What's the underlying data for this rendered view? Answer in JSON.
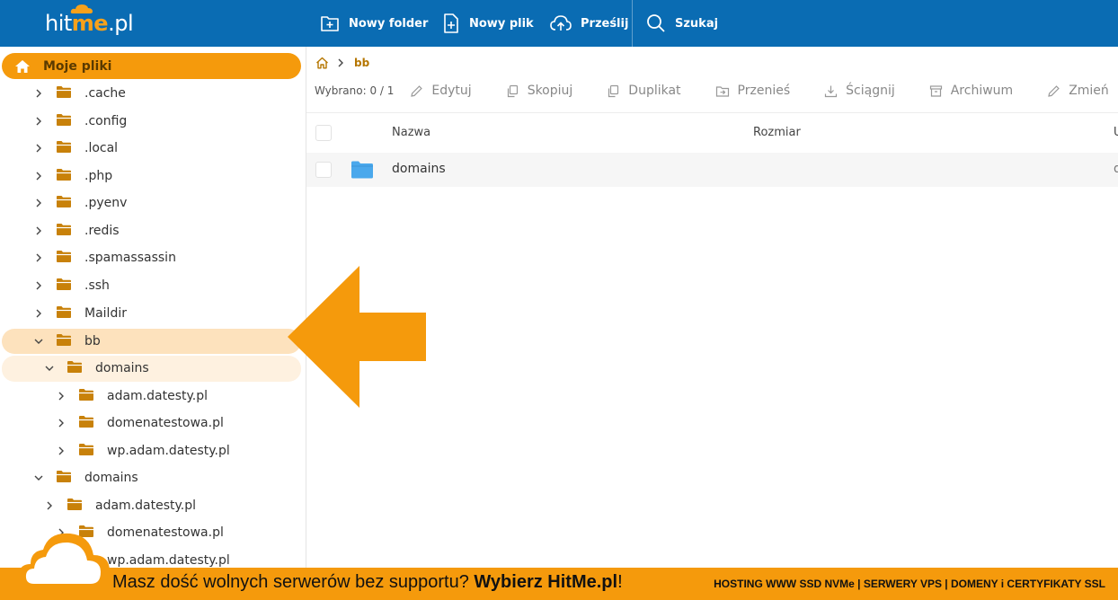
{
  "app": {
    "logo_text_hit": "hit",
    "logo_text_me": "me",
    "logo_text_tld": ".pl"
  },
  "toolbar": {
    "new_folder": "Nowy folder",
    "new_file": "Nowy plik",
    "upload": "Prześlij",
    "search": "Szukaj"
  },
  "sidebar": {
    "home_label": "Moje pliki",
    "items": [
      {
        "label": ".cache"
      },
      {
        "label": ".config"
      },
      {
        "label": ".local"
      },
      {
        "label": ".php"
      },
      {
        "label": ".pyenv"
      },
      {
        "label": ".redis"
      },
      {
        "label": ".spamassassin"
      },
      {
        "label": ".ssh"
      },
      {
        "label": "Maildir"
      },
      {
        "label": "bb"
      },
      {
        "label": "domains"
      },
      {
        "label": "adam.datesty.pl"
      },
      {
        "label": "domenatestowa.pl"
      },
      {
        "label": "wp.adam.datesty.pl"
      },
      {
        "label": "domains"
      },
      {
        "label": "adam.datesty.pl"
      },
      {
        "label": "domenatestowa.pl"
      },
      {
        "label": "wp.adam.datesty.pl"
      }
    ]
  },
  "main": {
    "breadcrumb": "bb",
    "selected": "Wybrano: 0 / 1",
    "actions": {
      "edit": "Edytuj",
      "copy": "Skopiuj",
      "duplicate": "Duplikat",
      "move": "Przenieś",
      "download": "Ściągnij",
      "archive": "Archiwum",
      "rename": "Zmień"
    },
    "columns": {
      "name": "Nazwa",
      "size": "Rozmiar",
      "extra": "U"
    },
    "rows": [
      {
        "name": "domains",
        "size": "",
        "extra": "d"
      }
    ]
  },
  "footer": {
    "slogan_plain": "Masz dość wolnych serwerów bez supportu? ",
    "slogan_bold": "Wybierz HitMe.pl",
    "slogan_end": "!",
    "tagline": "HOSTING WWW SSD NVMe | SERWERY VPS | DOMENY i CERTYFIKATY SSL"
  },
  "colors": {
    "topbar": "#0a6cb3",
    "accent": "#f59a0c",
    "folder_sidebar": "#c8810a",
    "folder_main": "#4aa8ec"
  }
}
